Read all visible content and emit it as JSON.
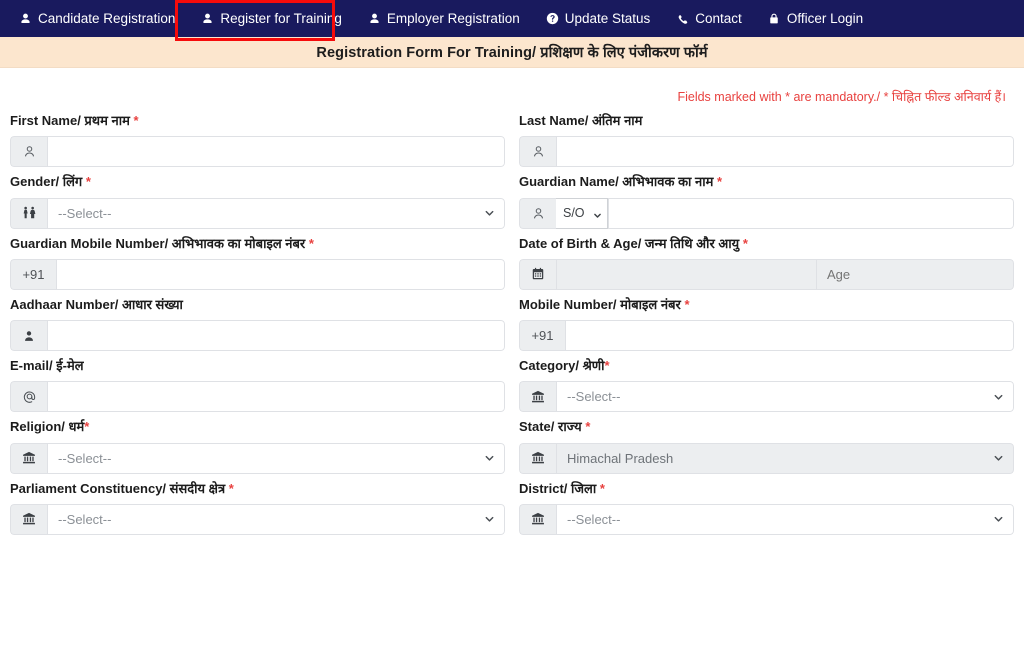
{
  "navbar": {
    "items": [
      {
        "label": "Candidate Registration",
        "icon": "user-icon"
      },
      {
        "label": "Register for Training",
        "icon": "user-icon",
        "highlighted": true
      },
      {
        "label": "Employer Registration",
        "icon": "user-icon"
      },
      {
        "label": "Update Status",
        "icon": "question-circle-icon"
      },
      {
        "label": "Contact",
        "icon": "phone-icon"
      },
      {
        "label": "Officer Login",
        "icon": "lock-icon"
      }
    ],
    "highlight_color": "#f60b0b",
    "background_color": "#191a5e"
  },
  "banner": {
    "title": "Registration Form For Training/ प्रशिक्षण के लिए पंजीकरण फॉर्म",
    "background_color": "#fce6ce"
  },
  "mandatory_note": "Fields marked with * are mandatory./ * चिह्नित फील्ड अनिवार्य हैं।",
  "mandatory_note_color": "#e8413f",
  "form": {
    "first_name": {
      "label": "First Name/ प्रथम नाम",
      "required": true,
      "icon": "user-outline-icon",
      "value": "",
      "placeholder": ""
    },
    "last_name": {
      "label": "Last Name/ अंतिम नाम",
      "required": false,
      "icon": "user-outline-icon",
      "value": "",
      "placeholder": ""
    },
    "gender": {
      "label": "Gender/ लिंग",
      "required": true,
      "icon": "gender-restroom-icon",
      "selected": "--Select--"
    },
    "guardian_name": {
      "label": "Guardian Name/ अभिभावक का नाम",
      "required": true,
      "icon": "user-outline-icon",
      "relation_selected": "S/O",
      "value": "",
      "placeholder": ""
    },
    "guardian_mobile": {
      "label": "Guardian Mobile Number/ अभिभावक का मोबाइल नंबर",
      "required": true,
      "prefix": "+91",
      "value": "",
      "placeholder": ""
    },
    "dob_age": {
      "label": "Date of Birth & Age/ जन्म तिथि और आयु",
      "required": true,
      "icon": "calendar-icon",
      "dob_value": "",
      "age_placeholder": "Age",
      "disabled": true
    },
    "aadhaar": {
      "label": "Aadhaar Number/ आधार संख्या",
      "required": false,
      "icon": "id-user-icon",
      "value": "",
      "placeholder": ""
    },
    "mobile": {
      "label": "Mobile Number/ मोबाइल नंबर",
      "required": true,
      "prefix": "+91",
      "value": "",
      "placeholder": ""
    },
    "email": {
      "label": "E-mail/ ई-मेल",
      "required": false,
      "icon": "at-sign-icon",
      "value": "",
      "placeholder": ""
    },
    "category": {
      "label": "Category/ श्रेणी",
      "required": true,
      "icon": "bank-icon",
      "selected": "--Select--"
    },
    "religion": {
      "label": "Religion/ धर्म",
      "required": true,
      "icon": "bank-icon",
      "selected": "--Select--"
    },
    "state": {
      "label": "State/ राज्य",
      "required": true,
      "icon": "bank-icon",
      "selected": "Himachal Pradesh",
      "disabled": true
    },
    "parliament_constituency": {
      "label": "Parliament Constituency/ संसदीय क्षेत्र",
      "required": true,
      "icon": "bank-icon",
      "selected": "--Select--"
    },
    "district": {
      "label": "District/ जिला",
      "required": true,
      "icon": "bank-icon",
      "selected": "--Select--"
    }
  }
}
